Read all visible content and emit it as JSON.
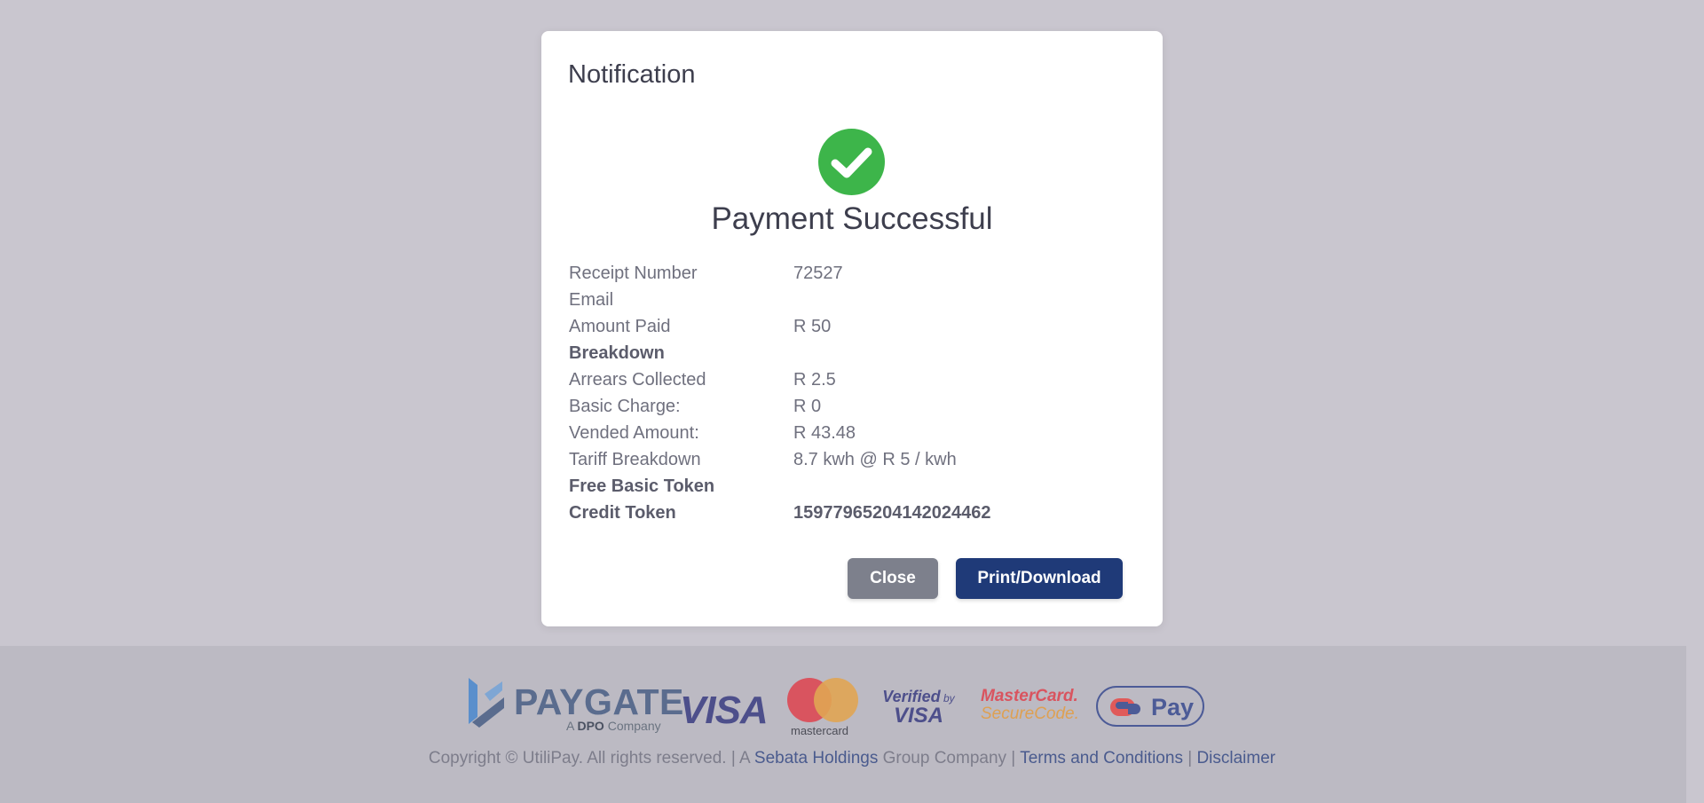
{
  "modal": {
    "title": "Notification",
    "status_heading": "Payment Successful",
    "success_color": "#3db54a",
    "rows": [
      {
        "label": "Receipt Number",
        "value": "72527",
        "bold": false
      },
      {
        "label": "Email",
        "value": "",
        "bold": false
      },
      {
        "label": "Amount Paid",
        "value": "R 50",
        "bold": false
      },
      {
        "label": "Breakdown",
        "value": "",
        "bold": true
      },
      {
        "label": "Arrears Collected",
        "value": "R 2.5",
        "bold": false
      },
      {
        "label": "Basic Charge:",
        "value": "R 0",
        "bold": false
      },
      {
        "label": "Vended Amount:",
        "value": "R 43.48",
        "bold": false
      },
      {
        "label": "Tariff Breakdown",
        "value": "8.7 kwh @ R 5 / kwh",
        "bold": false
      },
      {
        "label": "Free Basic Token",
        "value": "",
        "bold": true
      },
      {
        "label": "Credit Token",
        "value": "15977965204142024462",
        "bold": true
      }
    ],
    "close_label": "Close",
    "print_label": "Print/Download"
  },
  "footer": {
    "logos": {
      "paygate_word": "PAYGATE",
      "paygate_sub_prefix": "A ",
      "paygate_sub_brand": "DPO",
      "paygate_sub_suffix": " Company",
      "visa": "VISA",
      "mastercard": "mastercard",
      "verified_by": "Verified",
      "verified_by_small": "by",
      "verified_visa": "VISA",
      "mc_securecode_1": "MasterCard.",
      "mc_securecode_2": "SecureCode.",
      "scan_to_pay": "Pay"
    },
    "copyright_prefix": "Copyright © UtiliPay. All rights reserved. | A ",
    "sebata_link": "Sebata Holdings",
    "copyright_mid": " Group Company | ",
    "terms_link": "Terms and Conditions",
    "separator": " | ",
    "disclaimer_link": "Disclaimer"
  }
}
